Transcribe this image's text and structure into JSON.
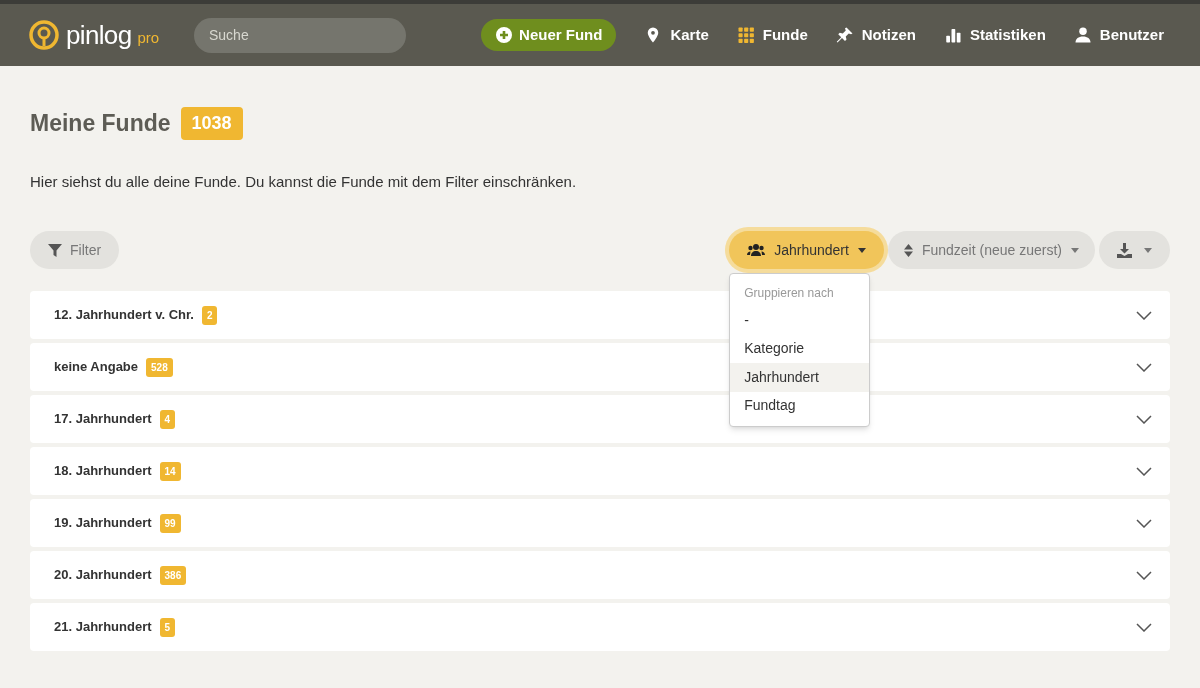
{
  "header": {
    "logo": {
      "name": "pinlog",
      "suffix": "pro"
    },
    "search": {
      "placeholder": "Suche"
    },
    "new_button": "Neuer Fund",
    "nav": [
      {
        "kind": "map",
        "label": "Karte",
        "selected": false
      },
      {
        "kind": "grid",
        "label": "Funde",
        "selected": true
      },
      {
        "kind": "pin",
        "label": "Notizen",
        "selected": false
      },
      {
        "kind": "chart",
        "label": "Statistiken",
        "selected": false
      },
      {
        "kind": "user",
        "label": "Benutzer",
        "selected": false
      }
    ]
  },
  "page": {
    "title": "Meine Funde",
    "count": "1038",
    "description": "Hier siehst du alle deine Funde. Du kannst die Funde mit dem Filter einschränken."
  },
  "toolbar": {
    "filter": "Filter",
    "group": "Jahrhundert",
    "sort": "Fundzeit (neue zuerst)"
  },
  "group_menu": {
    "expanded": true,
    "heading": "Gruppieren nach",
    "items": [
      {
        "label": "-",
        "selected": false
      },
      {
        "label": "Kategorie",
        "selected": false
      },
      {
        "label": "Jahrhundert",
        "selected": true
      },
      {
        "label": "Fundtag",
        "selected": false
      }
    ]
  },
  "groups": [
    {
      "label": "12. Jahrhundert v. Chr.",
      "count": "2",
      "expanded": false
    },
    {
      "label": "keine Angabe",
      "count": "528",
      "expanded": false
    },
    {
      "label": "17. Jahrhundert",
      "count": "4",
      "expanded": false
    },
    {
      "label": "18. Jahrhundert",
      "count": "14",
      "expanded": false
    },
    {
      "label": "19. Jahrhundert",
      "count": "99",
      "expanded": false
    },
    {
      "label": "20. Jahrhundert",
      "count": "386",
      "expanded": false
    },
    {
      "label": "21. Jahrhundert",
      "count": "5",
      "expanded": false
    }
  ]
}
